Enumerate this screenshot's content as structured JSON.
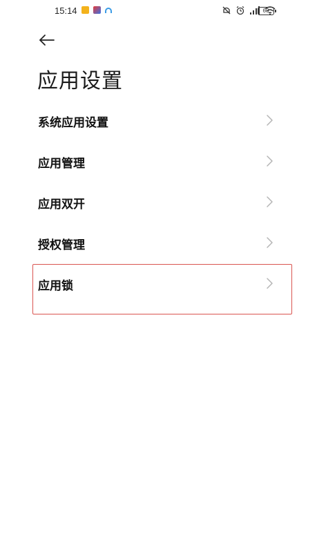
{
  "status_bar": {
    "time": "15:14",
    "battery": "60",
    "notification_icons": [
      "notification-app-icon",
      "notification-app-icon",
      "notification-cloud-icon"
    ],
    "system_icons": [
      "mute-icon",
      "alarm-icon",
      "signal-icon",
      "wifi-icon",
      "battery-icon"
    ]
  },
  "header": {
    "back_icon": "back-arrow-icon",
    "title": "应用设置"
  },
  "settings": {
    "items": [
      {
        "label": "系统应用设置"
      },
      {
        "label": "应用管理"
      },
      {
        "label": "应用双开"
      },
      {
        "label": "授权管理"
      },
      {
        "label": "应用锁"
      }
    ]
  },
  "colors": {
    "highlight_border": "#d9534f",
    "chevron": "#b5b5b5",
    "text": "#111111",
    "background": "#ffffff"
  }
}
